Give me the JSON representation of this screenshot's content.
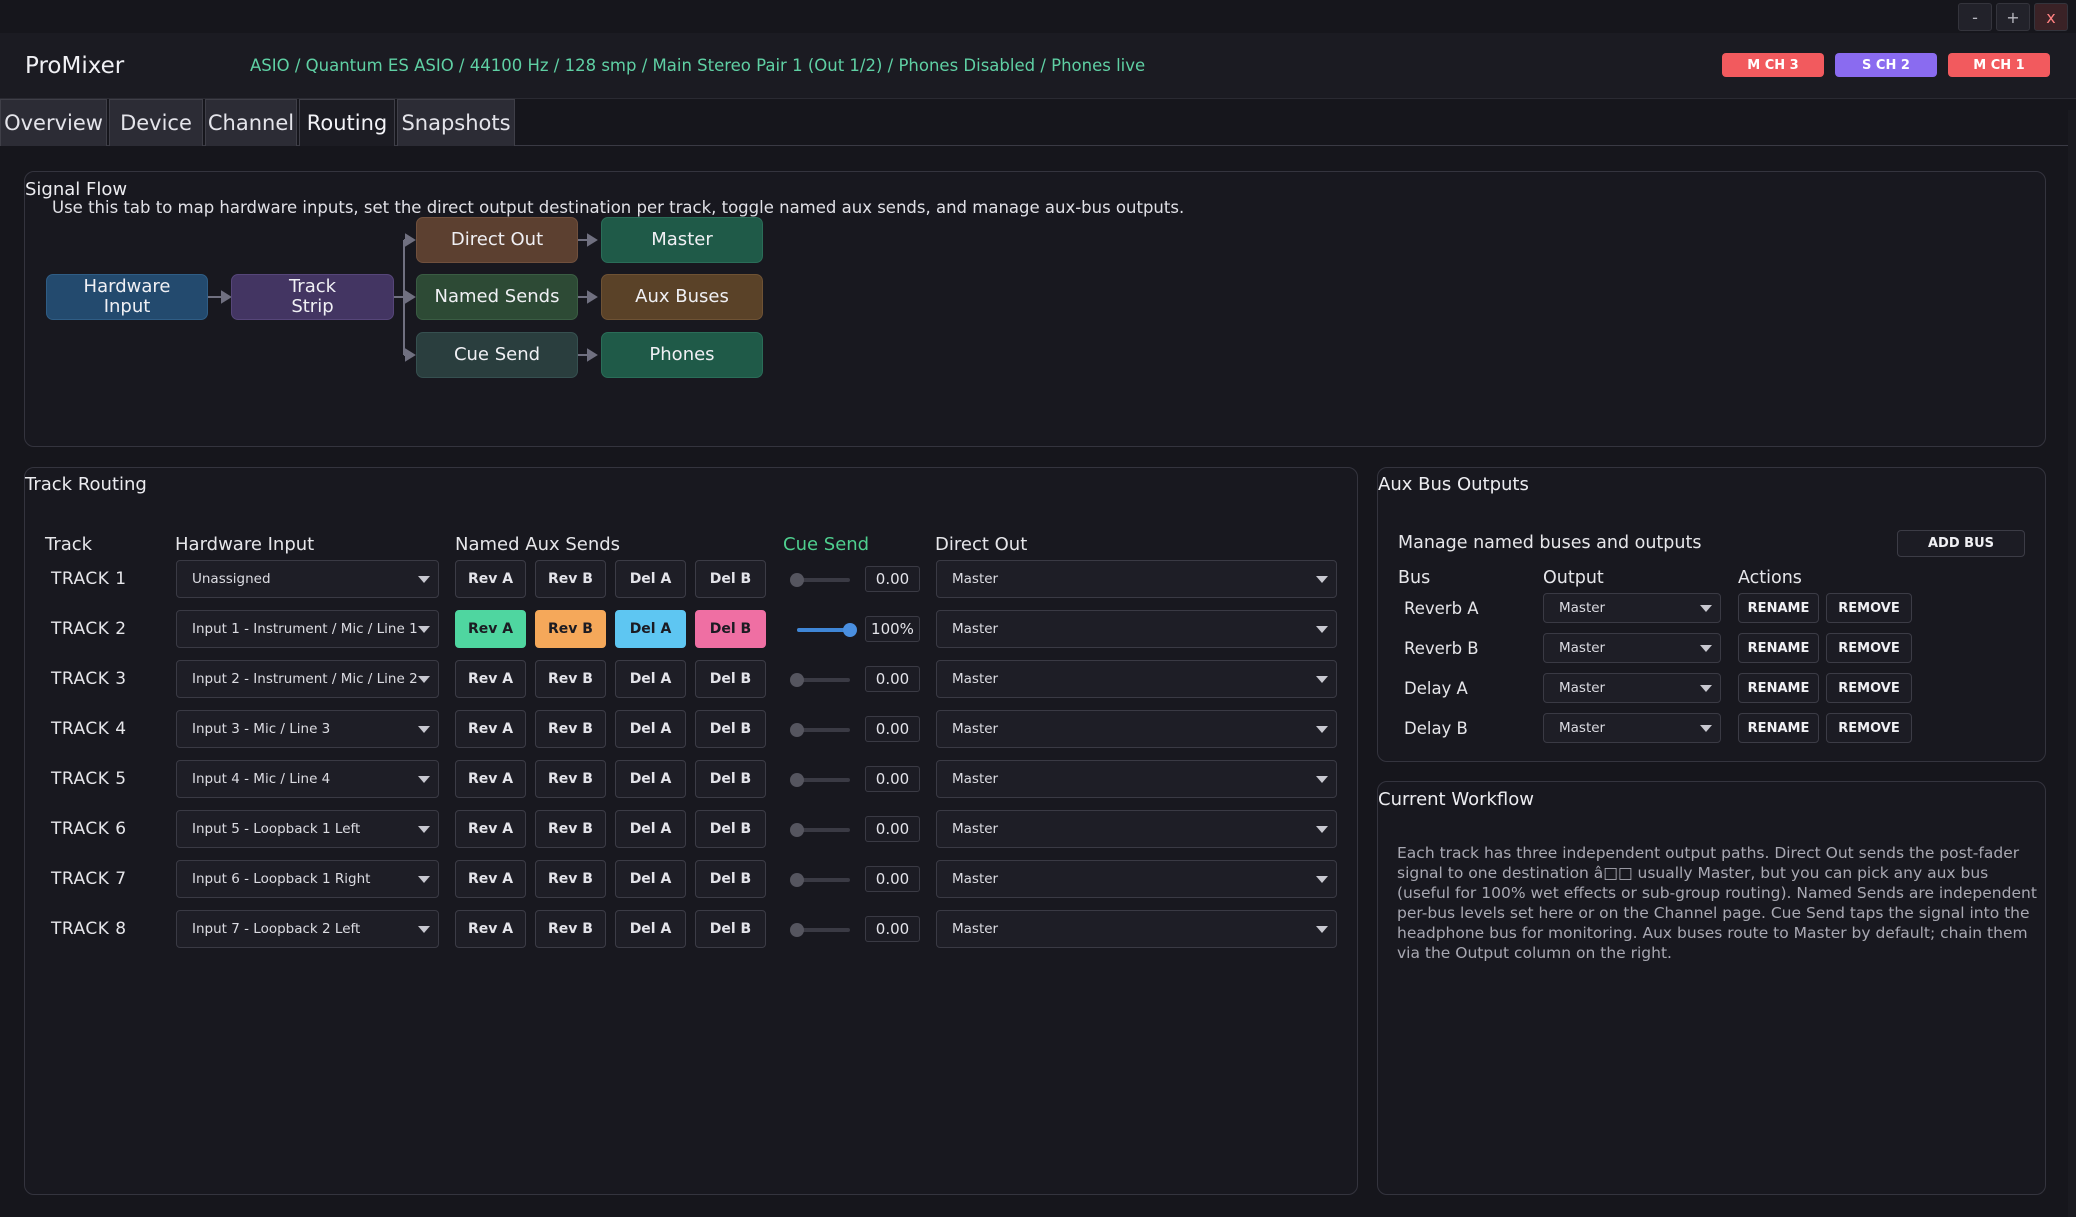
{
  "window": {
    "minimize": "-",
    "maximize": "+",
    "close": "x"
  },
  "header": {
    "title": "ProMixer",
    "status": "ASIO / Quantum ES ASIO / 44100 Hz / 128 smp / Main Stereo Pair 1 (Out 1/2) / Phones Disabled / Phones live",
    "chips": [
      {
        "label": "M CH 3",
        "color": "#f25a5e"
      },
      {
        "label": "S CH 2",
        "color": "#8a6bf0"
      },
      {
        "label": "M CH 1",
        "color": "#f25a5e"
      }
    ]
  },
  "tabs": [
    "Overview",
    "Device",
    "Channel",
    "Routing",
    "Snapshots"
  ],
  "active_tab": "Routing",
  "signal_flow": {
    "title": "Signal Flow",
    "description": "Use this tab to map hardware inputs, set the direct output destination per track, toggle named aux sends, and manage aux-bus outputs.",
    "nodes": {
      "hardware_input": "Hardware\nInput",
      "track_strip": "Track\nStrip",
      "direct_out": "Direct Out",
      "named_sends": "Named Sends",
      "cue_send": "Cue Send",
      "master": "Master",
      "aux_buses": "Aux Buses",
      "phones": "Phones"
    }
  },
  "track_routing": {
    "title": "Track Routing",
    "columns": {
      "track": "Track",
      "hardware_input": "Hardware Input",
      "named_aux_sends": "Named Aux Sends",
      "cue_send": "Cue Send",
      "direct_out": "Direct Out"
    },
    "send_labels": [
      "Rev A",
      "Rev B",
      "Del A",
      "Del B"
    ],
    "send_active_colors": [
      "#4fd6a0",
      "#f5a85a",
      "#5ec6f2",
      "#ef6fa3"
    ],
    "tracks": [
      {
        "name": "TRACK 1",
        "input": "Unassigned",
        "sends_active": [
          false,
          false,
          false,
          false
        ],
        "cue_value": "0.00",
        "cue_level": 0,
        "direct_out": "Master"
      },
      {
        "name": "TRACK 2",
        "input": "Input 1 - Instrument / Mic / Line 1",
        "sends_active": [
          true,
          true,
          true,
          true
        ],
        "cue_value": "100%",
        "cue_level": 1,
        "direct_out": "Master"
      },
      {
        "name": "TRACK 3",
        "input": "Input 2 - Instrument / Mic / Line 2",
        "sends_active": [
          false,
          false,
          false,
          false
        ],
        "cue_value": "0.00",
        "cue_level": 0,
        "direct_out": "Master"
      },
      {
        "name": "TRACK 4",
        "input": "Input 3 - Mic / Line 3",
        "sends_active": [
          false,
          false,
          false,
          false
        ],
        "cue_value": "0.00",
        "cue_level": 0,
        "direct_out": "Master"
      },
      {
        "name": "TRACK 5",
        "input": "Input 4 - Mic / Line 4",
        "sends_active": [
          false,
          false,
          false,
          false
        ],
        "cue_value": "0.00",
        "cue_level": 0,
        "direct_out": "Master"
      },
      {
        "name": "TRACK 6",
        "input": "Input 5 - Loopback 1 Left",
        "sends_active": [
          false,
          false,
          false,
          false
        ],
        "cue_value": "0.00",
        "cue_level": 0,
        "direct_out": "Master"
      },
      {
        "name": "TRACK 7",
        "input": "Input 6 - Loopback 1 Right",
        "sends_active": [
          false,
          false,
          false,
          false
        ],
        "cue_value": "0.00",
        "cue_level": 0,
        "direct_out": "Master"
      },
      {
        "name": "TRACK 8",
        "input": "Input 7 - Loopback 2 Left",
        "sends_active": [
          false,
          false,
          false,
          false
        ],
        "cue_value": "0.00",
        "cue_level": 0,
        "direct_out": "Master"
      }
    ]
  },
  "aux_bus_outputs": {
    "title": "Aux Bus Outputs",
    "subtitle": "Manage named buses and outputs",
    "add_bus_label": "ADD BUS",
    "columns": {
      "bus": "Bus",
      "output": "Output",
      "actions": "Actions"
    },
    "rename_label": "RENAME",
    "remove_label": "REMOVE",
    "buses": [
      {
        "name": "Reverb A",
        "output": "Master"
      },
      {
        "name": "Reverb B",
        "output": "Master"
      },
      {
        "name": "Delay A",
        "output": "Master"
      },
      {
        "name": "Delay B",
        "output": "Master"
      }
    ]
  },
  "current_workflow": {
    "title": "Current Workflow",
    "text": "Each track has three independent output paths. Direct Out sends the post-fader signal to one destination â□□ usually Master, but you can pick any aux bus (useful for 100% wet effects or sub-group routing). Named Sends are independent per-bus levels set here or on the Channel page. Cue Send taps the signal into the headphone bus for monitoring. Aux buses route to Master by default; chain them via the Output column on the right."
  }
}
